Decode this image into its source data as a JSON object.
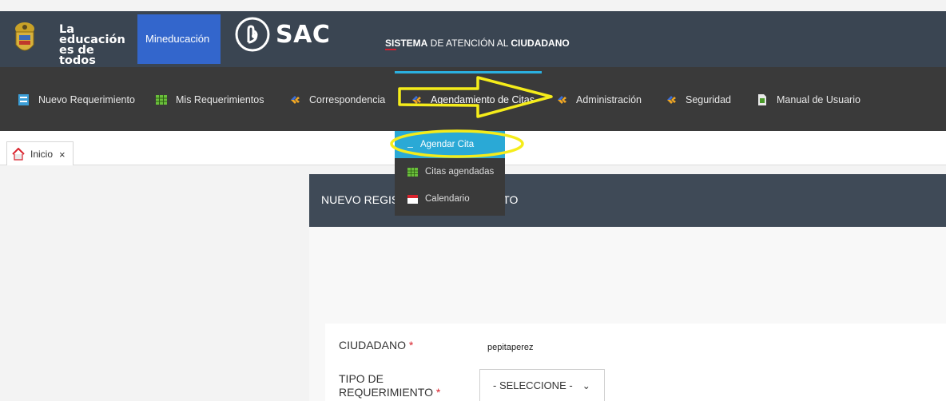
{
  "header": {
    "brand_line1": "La educación",
    "brand_line2": "es de todos",
    "mineducacion": "Mineducación",
    "app_name": "SAC",
    "system_part1": "SISTEMA",
    "system_part2": " DE ATENCIÓN AL ",
    "system_part3": "CIUDADANO"
  },
  "nav": {
    "items": [
      {
        "label": "Nuevo Requerimiento",
        "icon": "form-icon"
      },
      {
        "label": "Mis Requerimientos",
        "icon": "grid-icon"
      },
      {
        "label": "Correspondencia",
        "icon": "diamond-icon"
      },
      {
        "label": "Agendamiento de Citas",
        "icon": "diamond-icon"
      },
      {
        "label": "Administración",
        "icon": "diamond-icon"
      },
      {
        "label": "Seguridad",
        "icon": "diamond-icon"
      },
      {
        "label": "Manual de Usuario",
        "icon": "document-icon"
      }
    ],
    "dropdown": [
      {
        "label": "Agendar Cita",
        "active": true
      },
      {
        "label": "Citas agendadas",
        "active": false
      },
      {
        "label": "Calendario",
        "active": false
      }
    ]
  },
  "tabs": [
    {
      "label": "Inicio",
      "close": "×"
    }
  ],
  "panel": {
    "title_left": "NUEVO REGIS",
    "title_right": "TO"
  },
  "form": {
    "ciudadano_label": "CIUDADANO",
    "ciudadano_value": "pepitaperez",
    "tipo_label_line1": "TIPO DE",
    "tipo_label_line2": "REQUERIMIENTO",
    "required_mark": "*",
    "tipo_selected": "- SELECCIONE -"
  },
  "colors": {
    "topbar": "#3a4552",
    "navbar": "#3a3a3a",
    "accent_blue": "#2aa9d6",
    "highlight_yellow": "#f5ec1a",
    "brand_blue": "#3366cc"
  }
}
